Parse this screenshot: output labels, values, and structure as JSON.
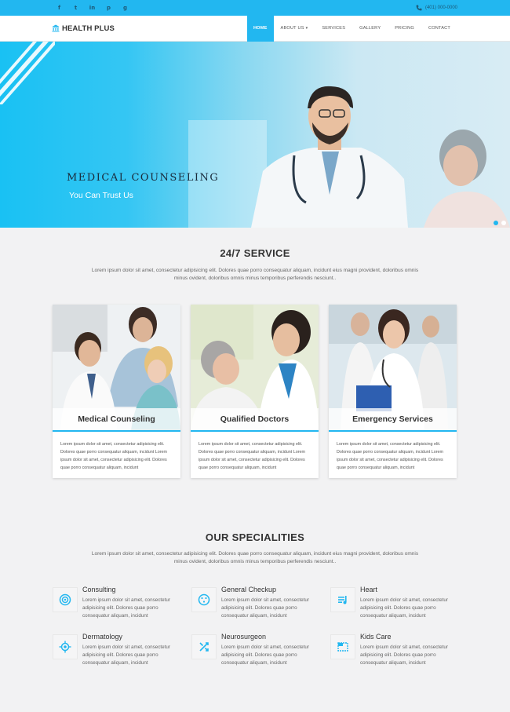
{
  "topbar": {
    "social": [
      "f",
      "t",
      "in",
      "p",
      "g"
    ],
    "phone": "(401) 000-0000"
  },
  "brand": {
    "name": "HEALTH PLUS",
    "icon": "hospital-icon"
  },
  "nav": {
    "items": [
      {
        "label": "HOME",
        "active": true
      },
      {
        "label": "ABOUT US",
        "dropdown": true
      },
      {
        "label": "SERVICES"
      },
      {
        "label": "GALLERY"
      },
      {
        "label": "PRICING"
      },
      {
        "label": "CONTACT"
      }
    ]
  },
  "hero": {
    "title": "MEDICAL COUNSELING",
    "subtitle": "You Can Trust Us",
    "slides": 2,
    "active_slide": 1
  },
  "service": {
    "title": "24/7 SERVICE",
    "desc": "Lorem ipsum dolor sit amet, consectetur adipisicing elit. Dolores quae porro consequatur aliquam, incidunt eius magni provident, doloribus omnis minus ovident, doloribus omnis minus temporibus perferendis nesciunt..",
    "cards": [
      {
        "title": "Medical Counseling",
        "text": "Lorem ipsum dolor sit amet, consectetur adipisicing elit. Dolores quae porro consequatur aliquam, incidunt Lorem ipsum dolor sit amet, consectetur adipisicing elit. Dolores quae porro consequatur aliquam, incidunt"
      },
      {
        "title": "Qualified Doctors",
        "text": "Lorem ipsum dolor sit amet, consectetur adipisicing elit. Dolores quae porro consequatur aliquam, incidunt Lorem ipsum dolor sit amet, consectetur adipisicing elit. Dolores quae porro consequatur aliquam, incidunt"
      },
      {
        "title": "Emergency Services",
        "text": "Lorem ipsum dolor sit amet, consectetur adipisicing elit. Dolores quae porro consequatur aliquam, incidunt Lorem ipsum dolor sit amet, consectetur adipisicing elit. Dolores quae porro consequatur aliquam, incidunt"
      }
    ]
  },
  "specialities": {
    "title": "OUR SPECIALITIES",
    "desc": "Lorem ipsum dolor sit amet, consectetur adipisicing elit. Dolores quae porro consequatur aliquam, incidunt eius magni provident, doloribus omnis minus ovident, doloribus omnis minus temporibus perferendis nesciunt..",
    "items": [
      {
        "title": "Consulting",
        "icon": "consulting-icon",
        "text": "Lorem ipsum dolor sit amet, consectetur adipisicing elit. Dolores quae porro consequatur aliquam, incidunt"
      },
      {
        "title": "General Checkup",
        "icon": "checkup-icon",
        "text": "Lorem ipsum dolor sit amet, consectetur adipisicing elit. Dolores quae porro consequatur aliquam, incidunt"
      },
      {
        "title": "Heart",
        "icon": "heart-icon",
        "text": "Lorem ipsum dolor sit amet, consectetur adipisicing elit. Dolores quae porro consequatur aliquam, incidunt"
      },
      {
        "title": "Dermatology",
        "icon": "dermatology-icon",
        "text": "Lorem ipsum dolor sit amet, consectetur adipisicing elit. Dolores quae porro consequatur aliquam, incidunt"
      },
      {
        "title": "Neurosurgeon",
        "icon": "neurosurgeon-icon",
        "text": "Lorem ipsum dolor sit amet, consectetur adipisicing elit. Dolores quae porro consequatur aliquam, incidunt"
      },
      {
        "title": "Kids Care",
        "icon": "kids-care-icon",
        "text": "Lorem ipsum dolor sit amet, consectetur adipisicing elit. Dolores quae porro consequatur aliquam, incidunt"
      }
    ]
  },
  "colors": {
    "accent": "#22b7f0",
    "text": "#333333",
    "bg": "#f2f2f3"
  }
}
